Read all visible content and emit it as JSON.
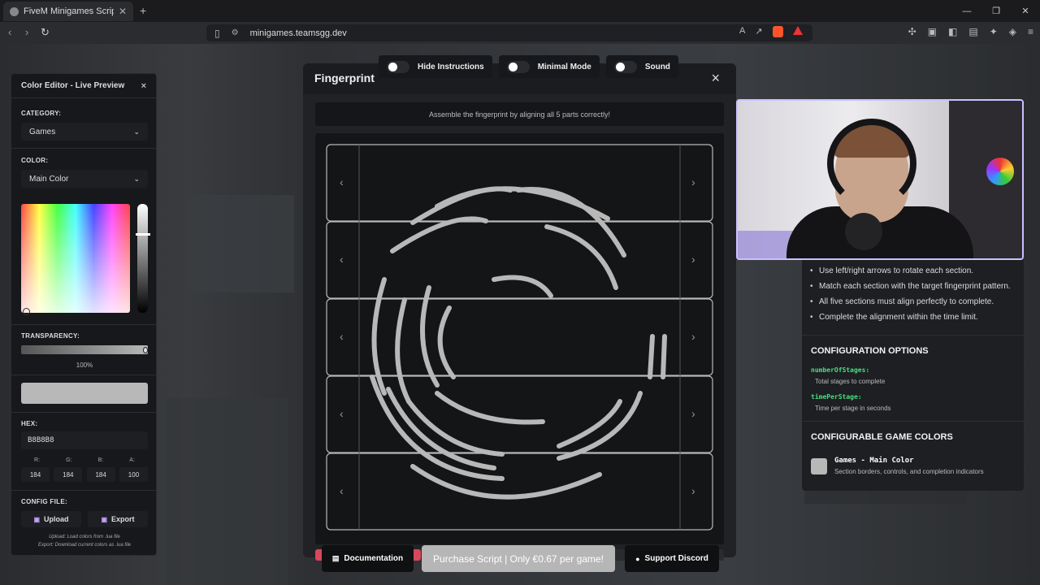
{
  "browser": {
    "tab_title": "FiveM Minigames Script - Interac",
    "new_tab": "+",
    "url": "minigames.teamsgg.dev"
  },
  "color_editor": {
    "title": "Color Editor - Live Preview",
    "close": "×",
    "category_label": "CATEGORY:",
    "category_value": "Games",
    "color_label": "COLOR:",
    "color_value": "Main Color",
    "transparency_label": "TRANSPARENCY:",
    "transparency_value": "100%",
    "preview_color": "#B8B8B8",
    "hex_label": "HEX:",
    "hex_value": "B8B8B8",
    "rgba_labels": [
      "R:",
      "G:",
      "B:",
      "A:"
    ],
    "rgba_values": [
      "184",
      "184",
      "184",
      "100"
    ],
    "config_label": "CONFIG FILE:",
    "upload_label": "Upload",
    "export_label": "Export",
    "upload_note": "Upload: Load colors from .lua file",
    "export_note": "Export: Download current colors as .lua file"
  },
  "toggles": [
    {
      "label": "Hide Instructions",
      "on": false
    },
    {
      "label": "Minimal Mode",
      "on": false
    },
    {
      "label": "Sound",
      "on": false
    }
  ],
  "game": {
    "title": "Fingerprint",
    "close": "×",
    "instruction": "Assemble the fingerprint by aligning all 5 parts correctly!",
    "main_color": "#B8B8B8",
    "sections": 5,
    "arrow_left": "‹",
    "arrow_right": "›"
  },
  "footer": {
    "documentation": "Documentation",
    "purchase": "Purchase Script | Only €0.67 per game!",
    "discord": "Support Discord"
  },
  "info_panel": {
    "instructions": [
      "Use left/right arrows to rotate each section.",
      "Match each section with the target fingerprint pattern.",
      "All five sections must align perfectly to complete.",
      "Complete the alignment within the time limit."
    ],
    "config_title": "CONFIGURATION OPTIONS",
    "options": [
      {
        "key": "numberOfStages:",
        "desc": "Total stages to complete"
      },
      {
        "key": "timePerStage:",
        "desc": "Time per stage in seconds"
      }
    ],
    "colors_title": "CONFIGURABLE GAME COLORS",
    "color_name": "Games - Main Color",
    "color_desc": "Section borders, controls, and completion indicators"
  }
}
